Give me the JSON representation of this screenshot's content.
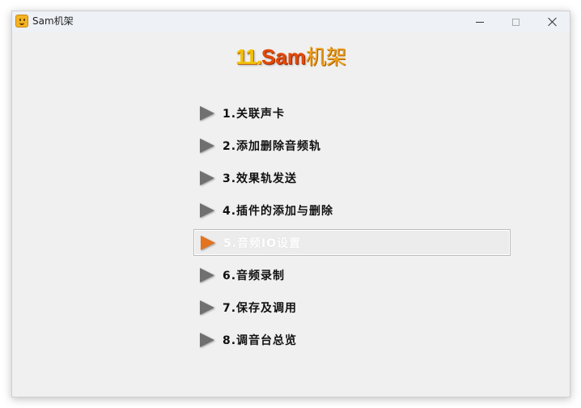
{
  "window": {
    "title": "Sam机架",
    "controls": {
      "minimize": "minimize",
      "maximize": "maximize",
      "close": "close"
    }
  },
  "logo": {
    "number": "11.",
    "name": "Sam",
    "chinese": "机架"
  },
  "menu": {
    "selected_index": 4,
    "items": [
      {
        "label": "1.关联声卡"
      },
      {
        "label": "2.添加删除音频轨"
      },
      {
        "label": "3.效果轨发送"
      },
      {
        "label": "4.插件的添加与删除"
      },
      {
        "label": "5.音频IO设置"
      },
      {
        "label": "6.音频录制"
      },
      {
        "label": "7.保存及调用"
      },
      {
        "label": "8.调音台总览"
      }
    ]
  },
  "colors": {
    "arrow": "#707070",
    "arrow_selected": "#e2731f",
    "window_bg": "#f0f0f0"
  }
}
